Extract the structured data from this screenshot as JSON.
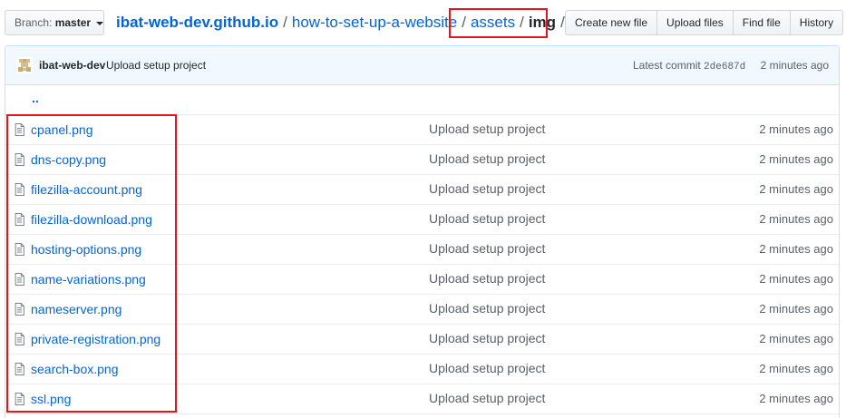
{
  "branch": {
    "label": "Branch:",
    "name": "master"
  },
  "breadcrumb": {
    "repo": "ibat-web-dev.github.io",
    "separator": "/",
    "folder": "how-to-set-up-a-website",
    "subfolder": "assets",
    "current": "img",
    "trailing": "/"
  },
  "actions": {
    "create": "Create new file",
    "upload": "Upload files",
    "find": "Find file",
    "history": "History"
  },
  "commit": {
    "author": "ibat-web-dev",
    "message": "Upload setup project",
    "latest_label": "Latest commit",
    "sha": "2de687d",
    "age": "2 minutes ago"
  },
  "parent_dir": "..",
  "files": [
    {
      "name": "cpanel.png",
      "message": "Upload setup project",
      "age": "2 minutes ago"
    },
    {
      "name": "dns-copy.png",
      "message": "Upload setup project",
      "age": "2 minutes ago"
    },
    {
      "name": "filezilla-account.png",
      "message": "Upload setup project",
      "age": "2 minutes ago"
    },
    {
      "name": "filezilla-download.png",
      "message": "Upload setup project",
      "age": "2 minutes ago"
    },
    {
      "name": "hosting-options.png",
      "message": "Upload setup project",
      "age": "2 minutes ago"
    },
    {
      "name": "name-variations.png",
      "message": "Upload setup project",
      "age": "2 minutes ago"
    },
    {
      "name": "nameserver.png",
      "message": "Upload setup project",
      "age": "2 minutes ago"
    },
    {
      "name": "private-registration.png",
      "message": "Upload setup project",
      "age": "2 minutes ago"
    },
    {
      "name": "search-box.png",
      "message": "Upload setup project",
      "age": "2 minutes ago"
    },
    {
      "name": "ssl.png",
      "message": "Upload setup project",
      "age": "2 minutes ago"
    }
  ],
  "colors": {
    "link": "#0366d6",
    "muted": "#586069",
    "commit_bar_bg": "#f1f8ff",
    "highlight_box": "#e3161e"
  },
  "icons": {
    "file": "file-icon",
    "avatar": "avatar-identicon",
    "caret": "caret-down-icon"
  }
}
